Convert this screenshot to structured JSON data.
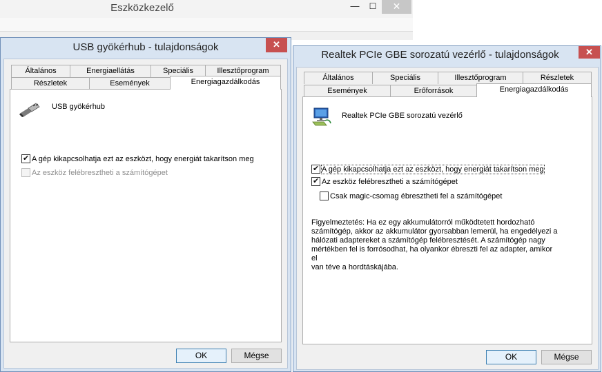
{
  "device_manager": {
    "title": "Eszközkezelő",
    "min_glyph": "—",
    "max_glyph": "☐",
    "close_glyph": "✕"
  },
  "usb_dialog": {
    "title": "USB gyökérhub - tulajdonságok",
    "close_glyph": "✕",
    "tabs_row1": [
      "Általános",
      "Energiaellátás",
      "Speciális",
      "Illesztőprogram"
    ],
    "tabs_row2": [
      "Részletek",
      "Események",
      "Energiagazdálkodás"
    ],
    "active_tab": "Energiagazdálkodás",
    "device_name": "USB gyökérhub",
    "options": [
      {
        "label": "A gép kikapcsolhatja ezt az eszközt, hogy energiát takarítson meg",
        "checked": true,
        "enabled": true
      },
      {
        "label": "Az eszköz felébresztheti a számítógépet",
        "checked": false,
        "enabled": false
      }
    ],
    "ok_label": "OK",
    "cancel_label": "Mégse"
  },
  "nic_dialog": {
    "title": "Realtek PCIe GBE sorozatú vezérlő - tulajdonságok",
    "close_glyph": "✕",
    "tabs_row1": [
      "Általános",
      "Speciális",
      "Illesztőprogram",
      "Részletek"
    ],
    "tabs_row2": [
      "Események",
      "Erőforrások",
      "Energiagazdálkodás"
    ],
    "active_tab": "Energiagazdálkodás",
    "device_name": "Realtek PCIe GBE sorozatú vezérlő",
    "options": [
      {
        "label": "A gép kikapcsolhatja ezt az eszközt, hogy energiát takarítson meg",
        "checked": true,
        "enabled": true
      },
      {
        "label": "Az eszköz felébresztheti a számítógépet",
        "checked": true,
        "enabled": true
      },
      {
        "label": "Csak magic-csomag ébresztheti fel a számítógépet",
        "checked": false,
        "enabled": true
      }
    ],
    "warning": "Figyelmeztetés: Ha ez egy akkumulátorról működtetett hordozható\nszámítógép, akkor az akkumulátor gyorsabban lemerül, ha engedélyezi a\nhálózati adaptereket a számítógép felébresztését. A számítógép nagy\nmértékben fel is forrósodhat, ha olyankor ébreszti fel az adapter, amikor el\nvan téve a hordtáskájába.",
    "ok_label": "OK",
    "cancel_label": "Mégse"
  },
  "colors": {
    "frame": "#d8e4f2",
    "close_button": "#c75050",
    "default_button_border": "#3c7fb1"
  }
}
